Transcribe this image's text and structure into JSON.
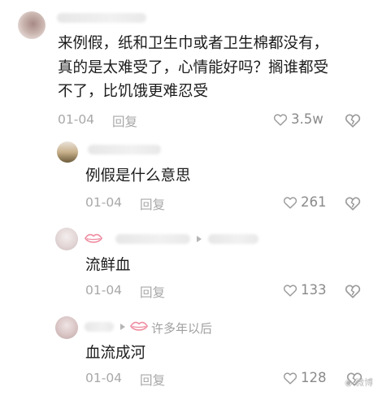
{
  "comments": [
    {
      "text_lines": [
        "来例假，纸和卫生巾或者卫生棉都没有，",
        "真的是太难受了，心情能好吗？搁谁都受",
        "不了，比饥饿更难忍受"
      ],
      "date": "01-04",
      "reply_label": "回复",
      "likes": "3.5w"
    },
    {
      "text_lines": [
        "例假是什么意思"
      ],
      "date": "01-04",
      "reply_label": "回复",
      "likes": "261"
    },
    {
      "text_lines": [
        "流鲜血"
      ],
      "date": "01-04",
      "reply_label": "回复",
      "likes": "133"
    },
    {
      "reply_to": "许多年以后",
      "text_lines": [
        "血流成河"
      ],
      "date": "01-04",
      "reply_label": "回复",
      "likes": "128"
    }
  ],
  "watermark": "微博",
  "colors": {
    "meta_gray": "#a8a8a8",
    "lips_pink": "#ef8fa3",
    "text_dark": "#1c1c1c"
  },
  "icons": {
    "like": "heart-outline-icon",
    "dislike": "broken-heart-icon",
    "reply_arrow": "triangle-right-icon",
    "badge": "lips-icon"
  }
}
